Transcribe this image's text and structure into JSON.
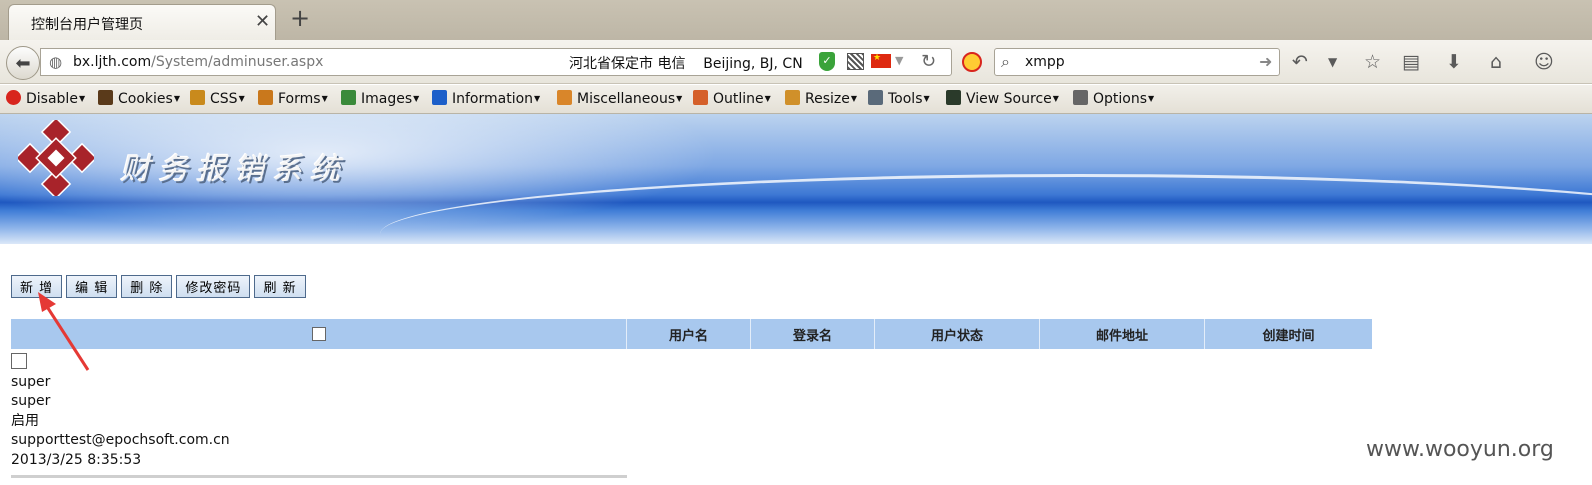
{
  "browser": {
    "tab_title": "控制台用户管理页",
    "new_tab_symbol": "+",
    "close_symbol": "✕",
    "url_host": "bx.ljth.com",
    "url_path": "/System/adminuser.aspx",
    "geo_text": "河北省保定市 电信    Beijing, BJ, CN",
    "search_value": "xmpp"
  },
  "devtoolbar": {
    "items": [
      {
        "label": "Disable",
        "icon": "disable-icon",
        "color": "#d8251d"
      },
      {
        "label": "Cookies",
        "icon": "cookies-icon",
        "color": "#5a3a1a"
      },
      {
        "label": "CSS",
        "icon": "css-wand-icon",
        "color": "#c98a1c"
      },
      {
        "label": "Forms",
        "icon": "forms-icon",
        "color": "#c9781c"
      },
      {
        "label": "Images",
        "icon": "images-icon",
        "color": "#3a8a3a"
      },
      {
        "label": "Information",
        "icon": "information-icon",
        "color": "#1c5fc9"
      },
      {
        "label": "Miscellaneous",
        "icon": "miscellaneous-icon",
        "color": "#d9862a"
      },
      {
        "label": "Outline",
        "icon": "outline-pencil-icon",
        "color": "#d5602a"
      },
      {
        "label": "Resize",
        "icon": "resize-ruler-icon",
        "color": "#d0902a"
      },
      {
        "label": "Tools",
        "icon": "tools-icon",
        "color": "#5a6a7a"
      },
      {
        "label": "View Source",
        "icon": "view-source-icon",
        "color": "#2a3a2a"
      },
      {
        "label": "Options",
        "icon": "options-icon",
        "color": "#666666"
      }
    ]
  },
  "banner": {
    "title": "财务报销系统"
  },
  "actions": {
    "add": "新 增",
    "edit": "编 辑",
    "delete": "删 除",
    "change_password": "修改密码",
    "refresh": "刷 新"
  },
  "grid": {
    "columns": [
      "用户名",
      "登录名",
      "用户状态",
      "邮件地址",
      "创建时间"
    ],
    "rows": [
      {
        "username": "super",
        "login_name": "super",
        "status": "启用",
        "email": "supporttest@epochsoft.com.cn",
        "created": "2013/3/25 8:35:53"
      }
    ]
  },
  "watermark": "www.wooyun.org",
  "colors": {
    "grid_header": "#a8c8ee",
    "button_border": "#4e6a8c",
    "arrow": "#e53935"
  }
}
